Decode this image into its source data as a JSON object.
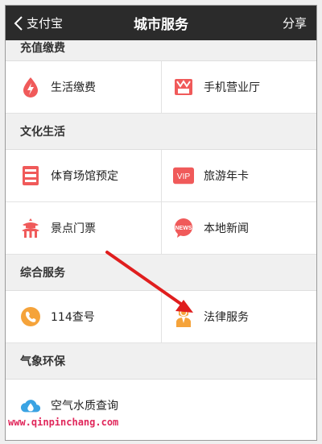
{
  "navbar": {
    "back_label": "支付宝",
    "title": "城市服务",
    "share_label": "分享"
  },
  "sections": {
    "recharge": {
      "title": "充值缴费",
      "items": [
        {
          "label": "生活缴费",
          "icon": "drop-bolt-icon"
        },
        {
          "label": "手机营业厅",
          "icon": "store-icon"
        }
      ]
    },
    "culture": {
      "title": "文化生活",
      "items": [
        {
          "label": "体育场馆预定",
          "icon": "stadium-icon"
        },
        {
          "label": "旅游年卡",
          "icon": "vip-icon",
          "icon_text": "VIP"
        },
        {
          "label": "景点门票",
          "icon": "pagoda-icon"
        },
        {
          "label": "本地新闻",
          "icon": "news-icon",
          "icon_text": "NEWS"
        }
      ]
    },
    "general": {
      "title": "综合服务",
      "items": [
        {
          "label": "114查号",
          "icon": "phone-icon"
        },
        {
          "label": "法律服务",
          "icon": "lawyer-icon"
        }
      ]
    },
    "environment": {
      "title": "气象环保",
      "items": [
        {
          "label": "空气水质查询",
          "icon": "cloud-drop-icon"
        }
      ]
    }
  },
  "colors": {
    "navbar_bg": "#2b2b2b",
    "red_icon": "#f05a5a",
    "orange_icon": "#f5a33a",
    "blue_icon": "#3aa3e3",
    "arrow": "#e01e1e",
    "watermark": "#e0265a"
  },
  "watermark": "www.qinpinchang.com"
}
